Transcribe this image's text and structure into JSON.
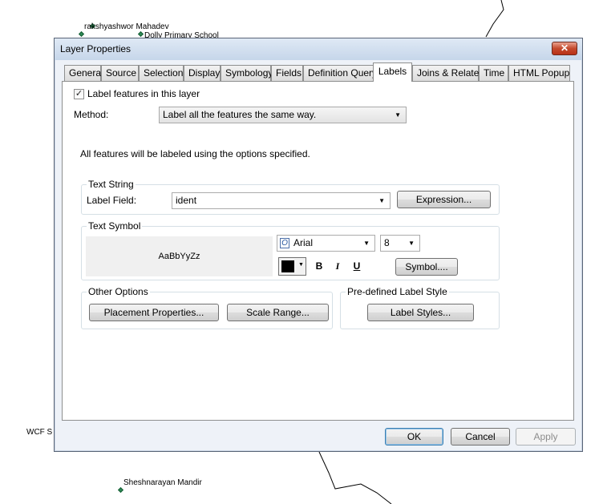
{
  "map": {
    "features": [
      "rakshyashwor Mahadev",
      "Dolly Primary School",
      "WCF S",
      "Sheshnarayan Mandir"
    ]
  },
  "dialog": {
    "title": "Layer Properties",
    "close_label": "✕",
    "tabs": [
      "General",
      "Source",
      "Selection",
      "Display",
      "Symbology",
      "Fields",
      "Definition Query",
      "Labels",
      "Joins & Relates",
      "Time",
      "HTML Popup"
    ],
    "active_tab": "Labels",
    "label_features_checked": "✓",
    "label_features_text": "Label features in this layer",
    "method_label": "Method:",
    "method_value": "Label all the features the same way.",
    "info_text": "All features will be labeled using the options specified.",
    "text_string": {
      "title": "Text String",
      "field_label": "Label Field:",
      "field_value": "ident",
      "expression_button": "Expression..."
    },
    "text_symbol": {
      "title": "Text Symbol",
      "preview_text": "AaBbYyZz",
      "font_value": "Arial",
      "size_value": "8",
      "color": "#000000",
      "bold": "B",
      "italic": "I",
      "underline": "U",
      "symbol_button": "Symbol...."
    },
    "other_options": {
      "title": "Other Options",
      "placement_button": "Placement Properties...",
      "scale_button": "Scale Range..."
    },
    "predefined": {
      "title": "Pre-defined Label Style",
      "styles_button": "Label Styles..."
    },
    "buttons": {
      "ok": "OK",
      "cancel": "Cancel",
      "apply": "Apply"
    }
  }
}
